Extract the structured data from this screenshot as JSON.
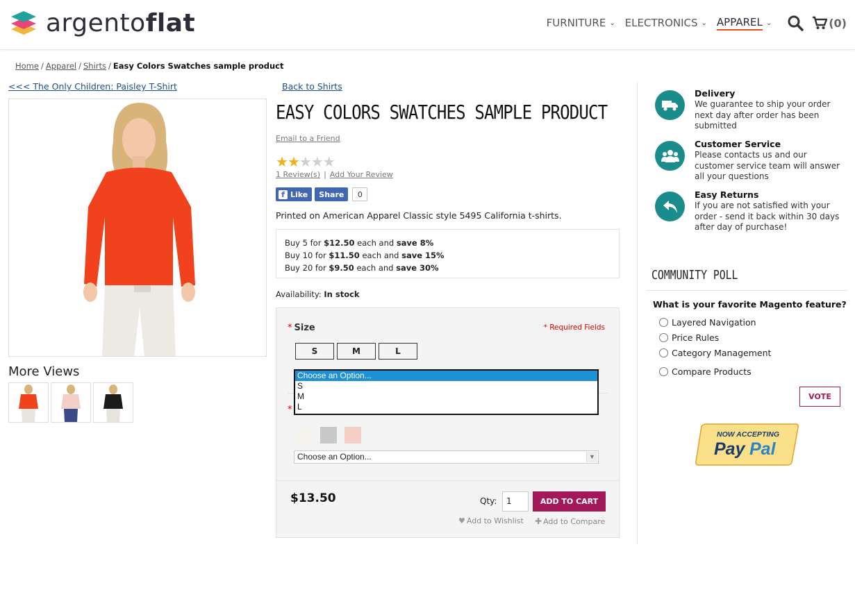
{
  "brand": {
    "name_light": "argento",
    "name_bold": "flat"
  },
  "nav": {
    "items": [
      {
        "label": "FURNITURE"
      },
      {
        "label": "ELECTRONICS"
      },
      {
        "label": "APPAREL"
      }
    ],
    "cart_count": "(0)"
  },
  "breadcrumb": {
    "items": [
      "Home",
      "Apparel",
      "Shirts"
    ],
    "current": "Easy Colors Swatches sample product"
  },
  "prev_link": "<<< The Only Children: Paisley T-Shirt",
  "back_link": "Back to Shirts",
  "more_views": "More Views",
  "product": {
    "title": "EASY COLORS SWATCHES SAMPLE PRODUCT",
    "email_friend": "Email to a Friend",
    "rating": 2,
    "reviews_link": "1 Review(s)",
    "add_review": "Add Your Review",
    "fb_like": "Like",
    "fb_share": "Share",
    "share_count": "0",
    "description": "Printed on American Apparel Classic style 5495 California t-shirts.",
    "tiers": [
      {
        "pre": "Buy 5 for ",
        "price": "$12.50",
        "mid": " each and ",
        "save": "save 8%"
      },
      {
        "pre": "Buy 10 for ",
        "price": "$11.50",
        "mid": " each and ",
        "save": "save 15%"
      },
      {
        "pre": "Buy 20 for ",
        "price": "$9.50",
        "mid": " each and ",
        "save": "save 30%"
      }
    ],
    "availability_label": "Availability:",
    "availability_value": "In stock",
    "price": "$13.50",
    "qty_label": "Qty:",
    "qty_value": "1",
    "add_to_cart": "ADD TO CART",
    "wishlist": "Add to Wishlist",
    "compare": "Add to Compare"
  },
  "options": {
    "size_label": "Size",
    "required_fields": "* Required Fields",
    "sizes": [
      "S",
      "M",
      "L"
    ],
    "size_dropdown": [
      "Choose an Option...",
      "S",
      "M",
      "L"
    ],
    "color_select_value": "Choose an Option...",
    "swatch_colors": [
      "#f6f4ee",
      "#c8c8c8",
      "#f6cfc6"
    ]
  },
  "features": [
    {
      "title": "Delivery",
      "text": "We guarantee to ship your order next day after order has been submitted",
      "icon": "truck-icon"
    },
    {
      "title": "Customer Service",
      "text": "Please contacts us and our customer service team will answer all your questions",
      "icon": "users-icon"
    },
    {
      "title": "Easy Returns",
      "text": "If you are not satisfied with your order - send it back within 30 days after day of purchase!",
      "icon": "return-icon"
    }
  ],
  "poll": {
    "title": "COMMUNITY POLL",
    "question": "What is your favorite Magento feature?",
    "options": [
      "Layered Navigation",
      "Price Rules",
      "Category Management",
      "Compare Products"
    ],
    "vote": "VOTE"
  },
  "paypal": {
    "top": "NOW ACCEPTING",
    "brand_a": "Pay",
    "brand_b": "Pal"
  },
  "colors": {
    "accent": "#a3185b",
    "teal": "#1b8c8c",
    "nav_active": "#e8501e"
  }
}
